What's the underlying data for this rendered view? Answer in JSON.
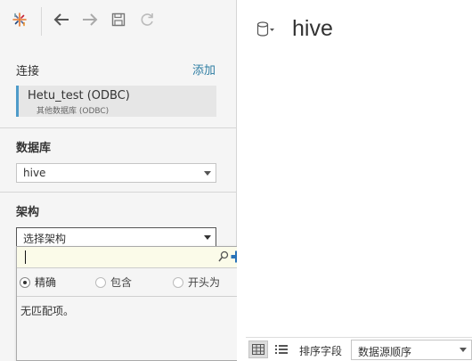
{
  "toolbar": {
    "icons": [
      "tableau-logo-icon",
      "back-arrow-icon",
      "forward-arrow-icon",
      "save-icon",
      "refresh-icon"
    ]
  },
  "connections": {
    "label": "连接",
    "add_label": "添加",
    "item": {
      "name": "Hetu_test (ODBC)",
      "subtitle": "其他数据库 (ODBC)"
    },
    "accent_color": "#4e9bc9"
  },
  "database": {
    "label": "数据库",
    "selected": "hive"
  },
  "schema": {
    "label": "架构",
    "selected": "选择架构",
    "popup": {
      "search_value": "",
      "options": [
        {
          "label": "精确",
          "checked": true
        },
        {
          "label": "包含",
          "checked": false
        },
        {
          "label": "开头为",
          "checked": false
        }
      ],
      "no_match_text": "无匹配项。"
    }
  },
  "canvas": {
    "title": "hive"
  },
  "bottom_bar": {
    "sort_label": "排序字段",
    "sort_selected": "数据源顺序"
  },
  "colors": {
    "link": "#2f7ea3",
    "popup_search_bg": "#fbfbe9",
    "add_plus": "#2a73b8"
  }
}
